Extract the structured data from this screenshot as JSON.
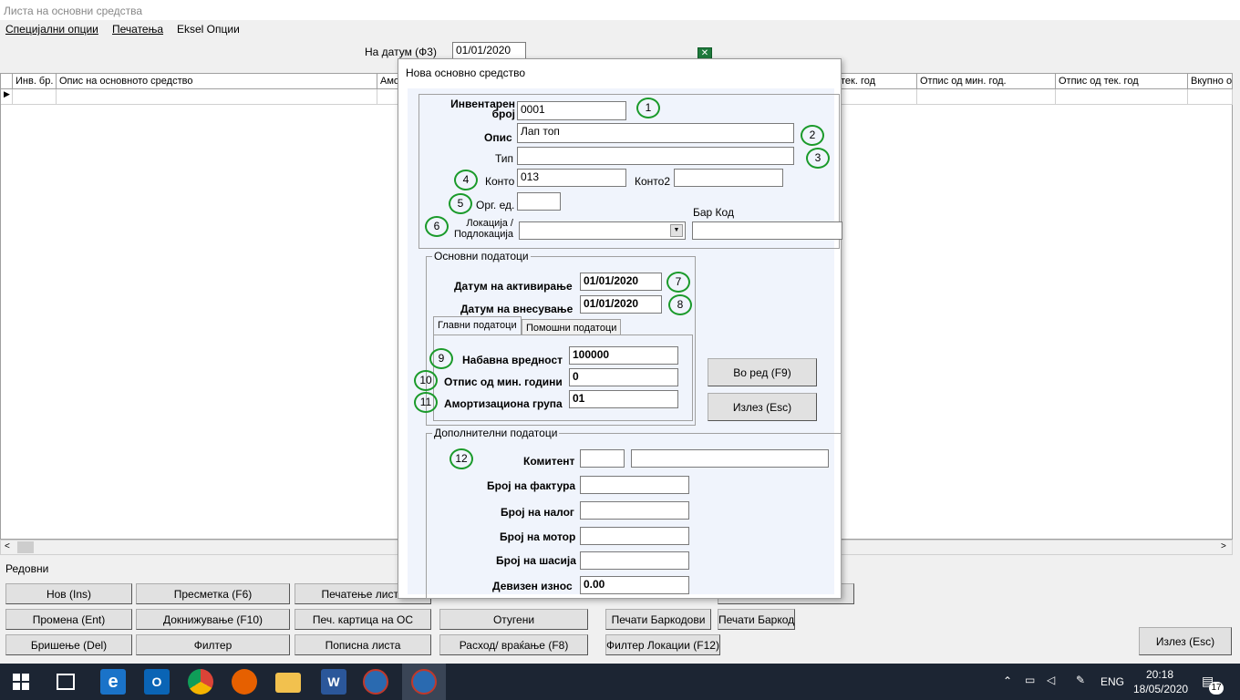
{
  "window": {
    "title": "Листа на основни средства"
  },
  "menu": {
    "items": [
      "Специјални опции",
      "Печатења",
      "Eksel Опции"
    ]
  },
  "toolbar": {
    "date_label": "На датум (Ф3)",
    "date_value": "01/01/2020"
  },
  "grid": {
    "columns": [
      "Инв. бр.",
      "Опис на основното средство",
      "Амо",
      "тек. год",
      "Отпис од мин. год.",
      "Отпис од тек. год",
      "Вкупно о"
    ]
  },
  "footer": {
    "rows_label": "Редовни",
    "buttons_row1": [
      "Нов (Ins)",
      "Пресметка (F6)",
      "Печатење листа",
      ""
    ],
    "buttons_row2": [
      "Промена (Ent)",
      "Докнижување (F10)",
      "Печ. картица на ОС",
      "Отугени",
      "Печати Баркодови",
      "Печати Баркод"
    ],
    "buttons_row3": [
      "Бришење (Del)",
      "Филтер",
      "Пописна листа",
      "Расход/ враќање (F8)",
      "Филтер Локации (F12)"
    ],
    "exit_button": "Излез (Esc)"
  },
  "dialog": {
    "title": "Нова основно средство",
    "inventory_label": "Инвентарен\nброј",
    "inventory_value": "0001",
    "desc_label": "Опис",
    "desc_value": "Лап топ",
    "type_label": "Тип",
    "type_value": "",
    "konto_label": "Конто",
    "konto_value": "013",
    "konto2_label": "Конто2",
    "konto2_value": "",
    "org_label": "Орг. ед.",
    "org_value": "",
    "location_label": "Локација /\nПодлокација",
    "barcode_label": "Бар Код",
    "basic_group": "Основни податоци",
    "activation_label": "Датум на активирање",
    "activation_value": "01/01/2020",
    "entry_label": "Датум на внесување",
    "entry_value": "01/01/2020",
    "tab_main": "Главни податоци",
    "tab_aux": "Помошни податоци",
    "purchase_label": "Набавна вредност",
    "purchase_value": "100000",
    "writeoff_label": "Отпис од мин. години",
    "writeoff_value": "0",
    "amort_label": "Амортизациона група",
    "amort_value": "01",
    "ok_button": "Во ред (F9)",
    "cancel_button": "Излез (Esc)",
    "extra_group": "Дополнителни податоци",
    "client_label": "Комитент",
    "invoice_label": "Број на фактура",
    "order_label": "Број на налог",
    "engine_label": "Број на мотор",
    "chassis_label": "Број на шасија",
    "currency_label": "Девизен износ",
    "currency_value": "0.00",
    "markers": [
      "1",
      "2",
      "3",
      "4",
      "5",
      "6",
      "7",
      "8",
      "9",
      "10",
      "11",
      "12"
    ]
  },
  "taskbar": {
    "lang": "ENG",
    "time": "20:18",
    "date": "18/05/2020",
    "notif": "17"
  },
  "colors": {
    "marker": "#1a9a2a",
    "taskbar": "#1c2533",
    "dialog_body": "#f0f4fc"
  }
}
